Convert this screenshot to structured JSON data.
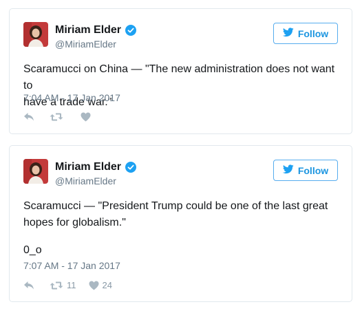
{
  "colors": {
    "accent": "#1da1f2",
    "follow_border": "#55acee",
    "muted": "#657786",
    "action_icon": "#aab8c2",
    "card_border": "#e1e8ed"
  },
  "tweets": [
    {
      "author_name": "Miriam Elder",
      "handle": "@MiriamElder",
      "verified": true,
      "follow_label": "Follow",
      "text_lines": [
        "Scaramucci on China — \"The new administration does not want to",
        "have a trade war.\""
      ],
      "emoticon": "",
      "timestamp": "7:04 AM - 17 Jan 2017",
      "retweet_count": "",
      "like_count": ""
    },
    {
      "author_name": "Miriam Elder",
      "handle": "@MiriamElder",
      "verified": true,
      "follow_label": "Follow",
      "text_lines": [
        "Scaramucci — \"President Trump could be one of the last great",
        "hopes for globalism.\""
      ],
      "emoticon": "0_o",
      "timestamp": "7:07 AM - 17 Jan 2017",
      "retweet_count": "11",
      "like_count": "24"
    }
  ],
  "icons": [
    "avatar",
    "verified-badge-icon",
    "twitter-bird-icon",
    "reply-icon",
    "retweet-icon",
    "heart-icon"
  ]
}
